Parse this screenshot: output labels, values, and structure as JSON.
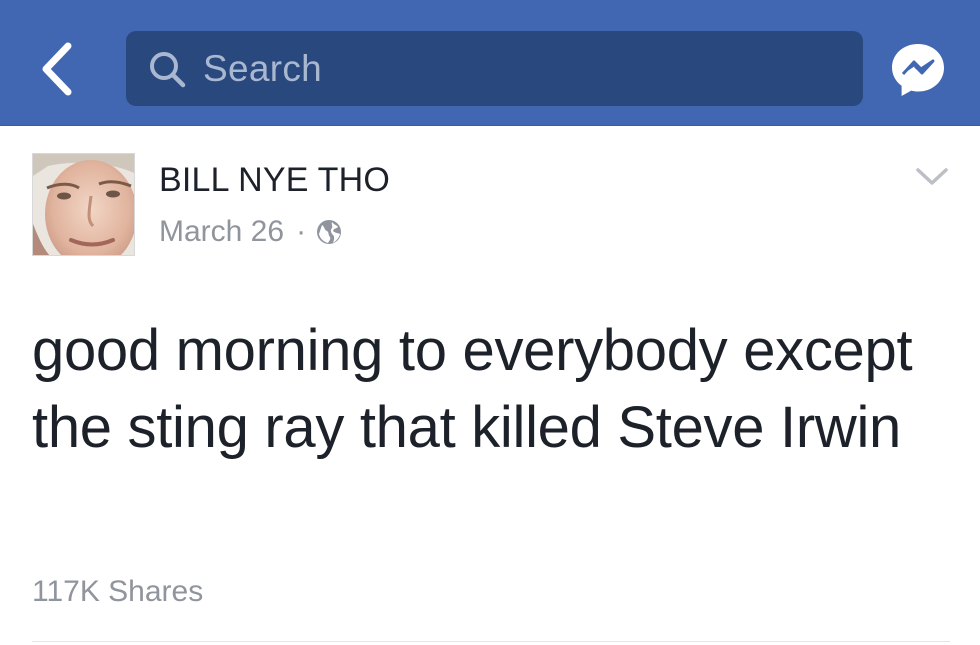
{
  "nav": {
    "back_icon": "chevron-left-icon",
    "search_placeholder": "Search",
    "search_icon": "search-icon",
    "messenger_icon": "messenger-icon",
    "bar_color": "#4267b2",
    "search_bg_color": "#29487d"
  },
  "post": {
    "author": "BILL NYE THO",
    "date": "March 26",
    "separator": "·",
    "privacy_icon": "globe-icon",
    "options_icon": "chevron-down-icon",
    "text": "good morning to everybody except the sting ray that killed Steve Irwin",
    "shares": "117K Shares"
  }
}
